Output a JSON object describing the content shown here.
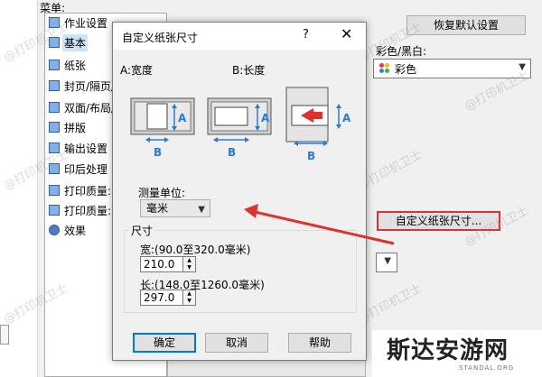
{
  "background": {
    "menu_label": "菜单:",
    "tree_items": [
      {
        "label": "作业设置",
        "icon": "job-settings-icon"
      },
      {
        "label": "基本",
        "icon": "basic-icon",
        "selected": true
      },
      {
        "label": "纸张",
        "icon": "paper-icon"
      },
      {
        "label": "封页/隔页/",
        "icon": "cover-page-icon"
      },
      {
        "label": "双面/布局/",
        "icon": "duplex-layout-icon"
      },
      {
        "label": "拼版",
        "icon": "imposition-icon"
      },
      {
        "label": "输出设置",
        "icon": "output-settings-icon"
      },
      {
        "label": "印后处理",
        "icon": "finishing-icon"
      },
      {
        "label": "打印质量:",
        "icon": "print-quality-icon"
      },
      {
        "label": "打印质量:",
        "icon": "print-quality-icon"
      },
      {
        "label": "效果",
        "icon": "effects-icon"
      }
    ],
    "restore_defaults": "恢复默认设置",
    "color_mode_label": "彩色/黑白:",
    "color_mode_value": "彩色",
    "custom_paper_size_button": "自定义纸张尺寸..."
  },
  "dialog": {
    "title": "自定义纸张尺寸",
    "help_glyph": "?",
    "close_glyph": "✕",
    "label_a": "A:宽度",
    "label_b": "B:长度",
    "unit_label": "测量单位:",
    "unit_value": "毫米",
    "size_group_label": "尺寸",
    "width_label": "宽:(90.0至320.0毫米)",
    "width_value": "210.0",
    "length_label": "长:(148.0至1260.0毫米)",
    "length_value": "297.0",
    "ok": "确定",
    "cancel": "取消",
    "help": "帮助"
  },
  "diagram_letters": {
    "a": "A",
    "b": "B"
  },
  "watermark": "@打印机卫士",
  "logo": {
    "text": "斯达安游网",
    "sub": "STANDAL.ORG"
  },
  "colors": {
    "accent": "#0078d7",
    "highlight": "#e03030",
    "diagram_blue": "#2b7bd5",
    "selection": "#cce4f7"
  }
}
